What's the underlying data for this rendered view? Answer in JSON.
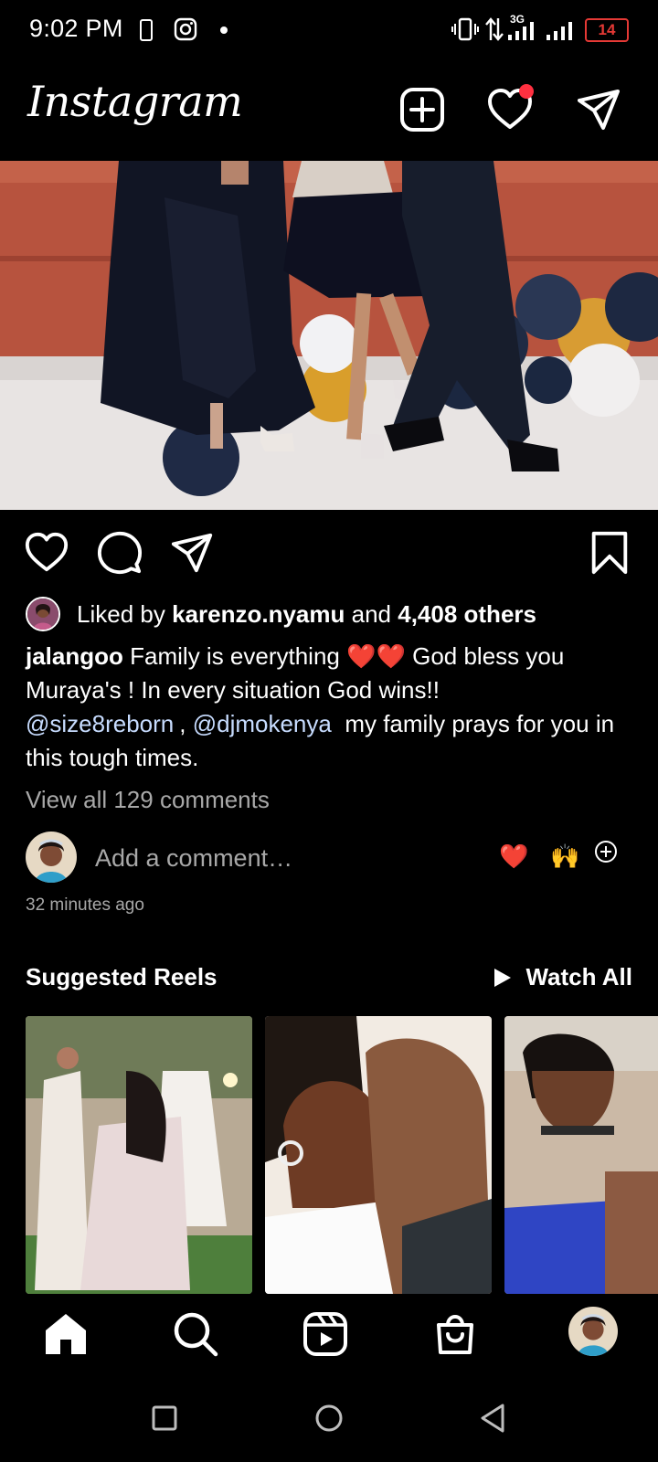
{
  "status_bar": {
    "time": "9:02 PM",
    "network": "3G",
    "battery": "14",
    "icons": [
      "phone-icon",
      "instagram-icon",
      "dot-icon",
      "vibrate-icon",
      "data-arrows-icon",
      "signal-icon",
      "signal-icon",
      "battery-icon"
    ]
  },
  "header": {
    "logo": "Instagram",
    "new_post_icon": "plus-square-icon",
    "activity_icon": "heart-icon",
    "direct_icon": "paper-plane-icon",
    "notification_dot_color": "#ff3040"
  },
  "post": {
    "actions": [
      "heart-icon",
      "comment-icon",
      "share-icon",
      "bookmark-icon"
    ],
    "liked_by_prefix": "Liked by",
    "liked_by_user": "karenzo.nyamu",
    "liked_by_and": "and",
    "liked_by_others": "4,408 others",
    "caption_user": "jalangoo",
    "caption_text_1": "Family is everything",
    "caption_hearts": "❤️❤️",
    "caption_text_2": "God bless you Muraya's ! In every situation God wins!!",
    "mention_1": "@size8reborn",
    "caption_comma": ",",
    "mention_2": "@djmokenya",
    "caption_text_3": "my family prays for you in this tough times.",
    "view_comments": "View all 129 comments",
    "comment_placeholder": "Add a comment…",
    "quick_reactions": [
      "❤️",
      "🙌"
    ],
    "add_reaction_icon": "plus-circle-icon",
    "timestamp": "32 minutes ago"
  },
  "suggested_reels": {
    "title": "Suggested Reels",
    "watch_all": "Watch All"
  },
  "bottom_nav": [
    "home-icon",
    "search-icon",
    "reels-icon",
    "shop-icon",
    "profile-avatar"
  ],
  "system_nav": [
    "recents-icon",
    "home-circle-icon",
    "back-icon"
  ],
  "colors": {
    "background": "#000000",
    "text": "#ffffff",
    "secondary_text": "#a8a8a8",
    "mention": "#c7dcff",
    "battery_low": "#e53935"
  }
}
